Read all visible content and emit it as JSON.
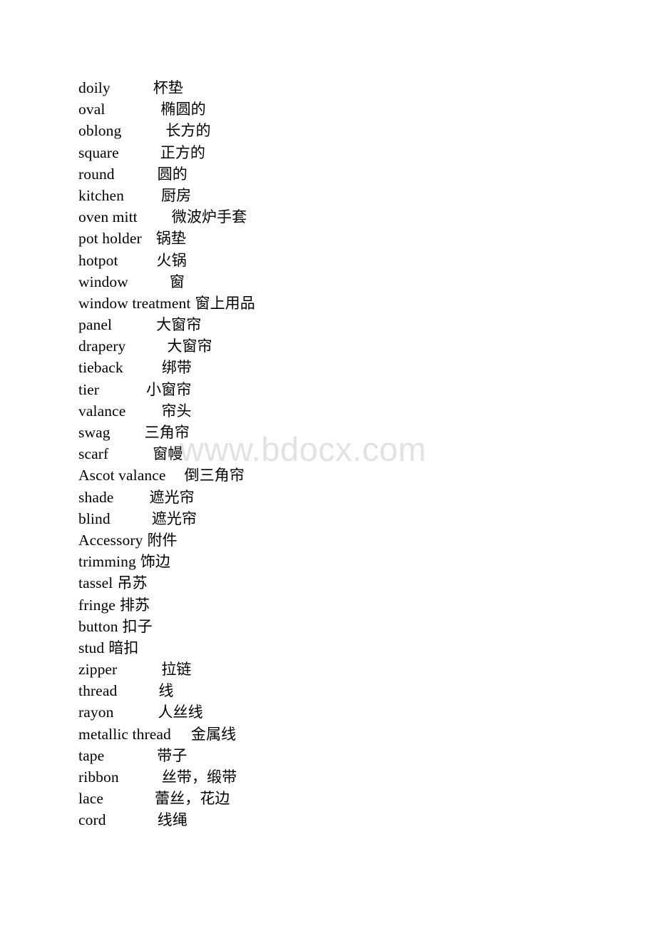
{
  "document": {
    "type": "bilingual-vocabulary-list",
    "background_color": "#ffffff",
    "text_color": "#000000"
  },
  "watermark": {
    "text": "www.bdocx.com",
    "color": "#e2e2e2"
  },
  "glossary": {
    "entries": [
      {
        "term": "doily",
        "gap": 60,
        "gloss": "杯垫"
      },
      {
        "term": "oval",
        "gap": 78,
        "gloss": "椭圆的"
      },
      {
        "term": "oblong",
        "gap": 62,
        "gloss": "长方的"
      },
      {
        "term": "square",
        "gap": 58,
        "gloss": "正方的"
      },
      {
        "term": "round",
        "gap": 60,
        "gloss": "圆的"
      },
      {
        "term": "kitchen",
        "gap": 52,
        "gloss": "厨房"
      },
      {
        "term": "oven mitt",
        "gap": 48,
        "gloss": "微波炉手套"
      },
      {
        "term": "pot holder",
        "gap": 20,
        "gloss": "锅垫"
      },
      {
        "term": "hotpot",
        "gap": 54,
        "gloss": "火锅"
      },
      {
        "term": "window",
        "gap": 58,
        "gloss": "窗"
      },
      {
        "term": "window treatment",
        "gap": 6,
        "gloss": "窗上用品"
      },
      {
        "term": "panel",
        "gap": 62,
        "gloss": "大窗帘"
      },
      {
        "term": "drapery",
        "gap": 58,
        "gloss": "大窗帘"
      },
      {
        "term": "tieback",
        "gap": 54,
        "gloss": "绑带"
      },
      {
        "term": "tier",
        "gap": 66,
        "gloss": "小窗帘"
      },
      {
        "term": "valance",
        "gap": 50,
        "gloss": "帘头"
      },
      {
        "term": "swag",
        "gap": 48,
        "gloss": "三角帘"
      },
      {
        "term": "scarf",
        "gap": 62,
        "gloss": "窗幔"
      },
      {
        "term": "Ascot valance",
        "gap": 26,
        "gloss": "倒三角帘"
      },
      {
        "term": "shade",
        "gap": 50,
        "gloss": "遮光帘"
      },
      {
        "term": "blind",
        "gap": 58,
        "gloss": "遮光帘"
      },
      {
        "term": "Accessory",
        "gap": 6,
        "gloss": "附件"
      },
      {
        "term": "trimming",
        "gap": 6,
        "gloss": "饰边"
      },
      {
        "term": "tassel",
        "gap": 6,
        "gloss": "吊苏"
      },
      {
        "term": "fringe",
        "gap": 6,
        "gloss": "排苏"
      },
      {
        "term": "button",
        "gap": 6,
        "gloss": "扣子"
      },
      {
        "term": "stud",
        "gap": 6,
        "gloss": "暗扣"
      },
      {
        "term": "zipper",
        "gap": 62,
        "gloss": "拉链"
      },
      {
        "term": "thread",
        "gap": 58,
        "gloss": "线"
      },
      {
        "term": "rayon",
        "gap": 62,
        "gloss": "人丝线"
      },
      {
        "term": "metallic thread",
        "gap": 28,
        "gloss": "金属线"
      },
      {
        "term": "tape",
        "gap": 74,
        "gloss": "带子"
      },
      {
        "term": "ribbon",
        "gap": 60,
        "gloss": "丝带，缎带"
      },
      {
        "term": "lace",
        "gap": 72,
        "gloss": "蕾丝，花边"
      },
      {
        "term": "cord",
        "gap": 72,
        "gloss": "线绳"
      }
    ]
  }
}
